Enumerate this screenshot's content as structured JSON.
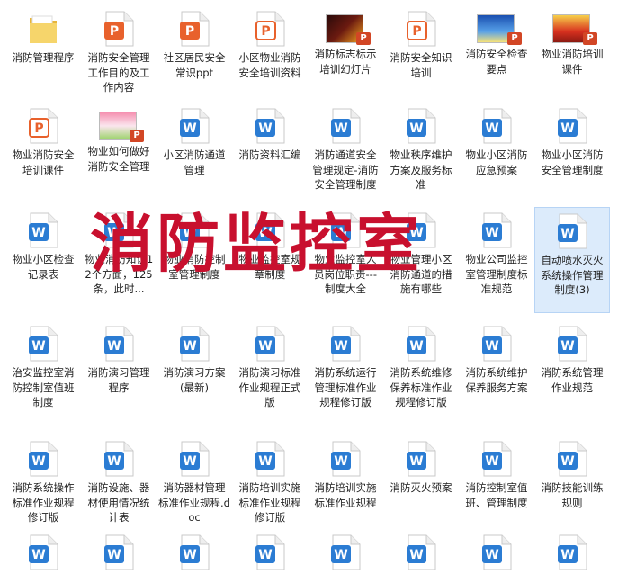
{
  "files": [
    {
      "label": "消防管理程序",
      "type": "folder"
    },
    {
      "label": "消防安全管理工作目的及工作内容",
      "type": "ppt"
    },
    {
      "label": "社区居民安全常识ppt",
      "type": "ppt"
    },
    {
      "label": "小区物业消防安全培训资料",
      "type": "ppt_outline"
    },
    {
      "label": "消防标志标示培训幻灯片",
      "type": "ppt_thumb_dark"
    },
    {
      "label": "消防安全知识培训",
      "type": "ppt_outline"
    },
    {
      "label": "消防安全检查要点",
      "type": "ppt_thumb_blue"
    },
    {
      "label": "物业消防培训课件",
      "type": "ppt_thumb_red"
    },
    {
      "label": "物业消防安全培训课件",
      "type": "ppt_outline"
    },
    {
      "label": "物业如何做好消防安全管理",
      "type": "ppt_thumb_pink"
    },
    {
      "label": "小区消防通道管理",
      "type": "word"
    },
    {
      "label": "消防资料汇编",
      "type": "word"
    },
    {
      "label": "消防通道安全管理规定-消防安全管理制度",
      "type": "word"
    },
    {
      "label": "物业秩序维护方案及服务标准",
      "type": "word"
    },
    {
      "label": "物业小区消防应急预案",
      "type": "word"
    },
    {
      "label": "物业小区消防安全管理制度",
      "type": "word"
    },
    {
      "label": "物业小区检查记录表",
      "type": "word"
    },
    {
      "label": "物业消防知识12个方面，125条，此时...",
      "type": "word"
    },
    {
      "label": "物业消防控制室管理制度",
      "type": "word"
    },
    {
      "label": "物业监控室规章制度",
      "type": "word"
    },
    {
      "label": "物业监控室人员岗位职责---制度大全",
      "type": "word"
    },
    {
      "label": "物业管理小区消防通道的措施有哪些",
      "type": "word"
    },
    {
      "label": "物业公司监控室管理制度标准规范",
      "type": "word"
    },
    {
      "label": "自动喷水灭火系统操作管理制度(3)",
      "type": "word",
      "selected": true
    },
    {
      "label": "治安监控室消防控制室值班制度",
      "type": "word"
    },
    {
      "label": "消防演习管理程序",
      "type": "word"
    },
    {
      "label": "消防演习方案(最新)",
      "type": "word"
    },
    {
      "label": "消防演习标准作业规程正式版",
      "type": "word"
    },
    {
      "label": "消防系统运行管理标准作业规程修订版",
      "type": "word"
    },
    {
      "label": "消防系统维修保养标准作业规程修订版",
      "type": "word"
    },
    {
      "label": "消防系统维护保养服务方案",
      "type": "word"
    },
    {
      "label": "消防系统管理作业规范",
      "type": "word"
    },
    {
      "label": "消防系统操作标准作业规程修订版",
      "type": "word"
    },
    {
      "label": "消防设施、器材使用情况统计表",
      "type": "word"
    },
    {
      "label": "消防器材管理标准作业规程.doc",
      "type": "word"
    },
    {
      "label": "消防培训实施标准作业规程修订版",
      "type": "word"
    },
    {
      "label": "消防培训实施标准作业规程",
      "type": "word"
    },
    {
      "label": "消防灭火预案",
      "type": "word"
    },
    {
      "label": "消防控制室值班、管理制度",
      "type": "word"
    },
    {
      "label": "消防技能训练规则",
      "type": "word"
    },
    {
      "label": "",
      "type": "word"
    },
    {
      "label": "",
      "type": "word"
    },
    {
      "label": "",
      "type": "word"
    },
    {
      "label": "",
      "type": "word"
    },
    {
      "label": "",
      "type": "word"
    },
    {
      "label": "",
      "type": "word"
    },
    {
      "label": "",
      "type": "word"
    },
    {
      "label": "",
      "type": "word"
    }
  ],
  "watermark": "消防监控室",
  "colors": {
    "word": "#2b7cd3",
    "ppt": "#e8612c",
    "watermark": "#c8102e",
    "folder": "#f2c94c"
  }
}
